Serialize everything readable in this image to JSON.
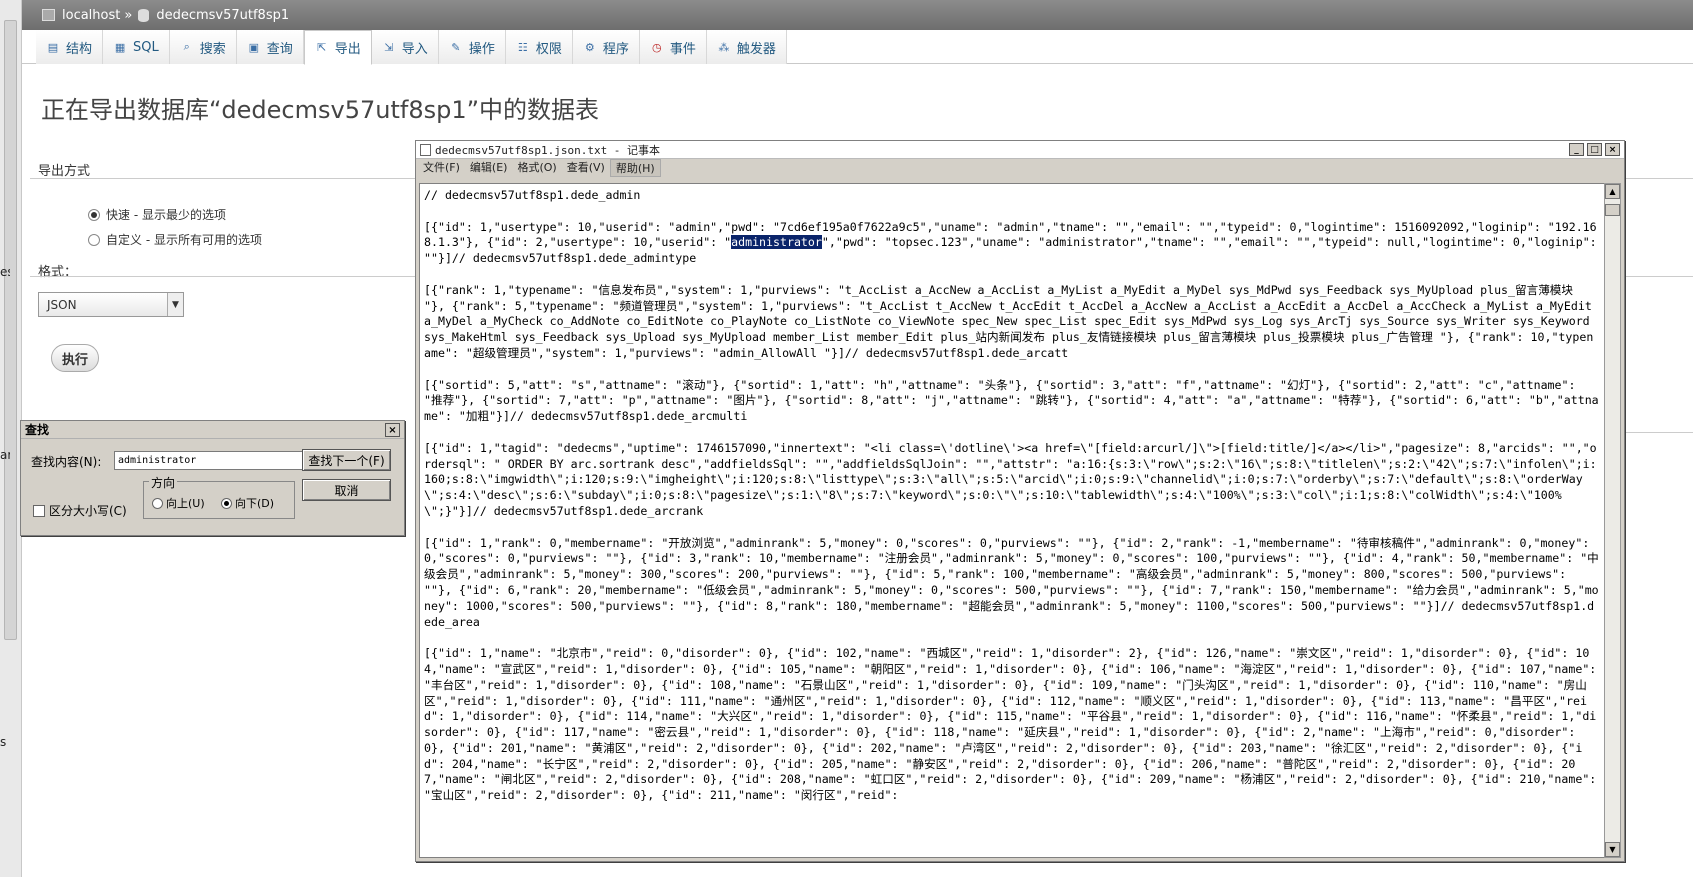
{
  "breadcrumb": {
    "server": "localhost",
    "separator": "»",
    "database": "dedecmsv57utf8sp1"
  },
  "tabs": [
    {
      "label": "结构",
      "icon": "structure-icon"
    },
    {
      "label": "SQL",
      "icon": "sql-icon"
    },
    {
      "label": "搜索",
      "icon": "search-icon"
    },
    {
      "label": "查询",
      "icon": "query-icon"
    },
    {
      "label": "导出",
      "icon": "export-icon"
    },
    {
      "label": "导入",
      "icon": "import-icon"
    },
    {
      "label": "操作",
      "icon": "wrench-icon"
    },
    {
      "label": "权限",
      "icon": "privileges-icon"
    },
    {
      "label": "程序",
      "icon": "routines-icon"
    },
    {
      "label": "事件",
      "icon": "clock-icon"
    },
    {
      "label": "触发器",
      "icon": "triggers-icon"
    }
  ],
  "active_tab": "导出",
  "page": {
    "title": "正在导出数据库“dedecmsv57utf8sp1”中的数据表",
    "export_method_label": "导出方式",
    "options": [
      {
        "label": "快速 - 显示最少的选项",
        "checked": true
      },
      {
        "label": "自定义 - 显示所有可用的选项",
        "checked": false
      }
    ],
    "format_label": "格式：",
    "format_value": "JSON",
    "execute_label": "执行"
  },
  "left_fragments": [
    "es",
    "ar",
    "s"
  ],
  "find_dialog": {
    "title": "查找",
    "close": "×",
    "find_what_label": "查找内容(N):",
    "find_value": "administrator",
    "find_next_label": "查找下一个(F)",
    "cancel_label": "取消",
    "direction_label": "方向",
    "up_label": "向上(U)",
    "down_label": "向下(D)",
    "match_case_label": "区分大小写(C)"
  },
  "notepad": {
    "title": "dedecmsv57utf8sp1.json.txt - 记事本",
    "menu": [
      "文件(F)",
      "编辑(E)",
      "格式(O)",
      "查看(V)",
      "帮助(H)"
    ],
    "controls": [
      "_",
      "□",
      "×"
    ],
    "text_before": "// dedecmsv57utf8sp1.dede_admin\n\n[{\"id\": 1,\"usertype\": 10,\"userid\": \"admin\",\"pwd\": \"7cd6ef195a0f7622a9c5\",\"uname\": \"admin\",\"tname\": \"\",\"email\": \"\",\"typeid\": 0,\"logintime\": 1516092092,\"loginip\": \"192.168.1.3\"}, {\"id\": 2,\"usertype\": 10,\"userid\": \"",
    "highlight": "administrator",
    "text_after": "\",\"pwd\": \"topsec.123\",\"uname\": \"administrator\",\"tname\": \"\",\"email\": \"\",\"typeid\": null,\"logintime\": 0,\"loginip\": \"\"}]// dedecmsv57utf8sp1.dede_admintype\n\n[{\"rank\": 1,\"typename\": \"信息发布员\",\"system\": 1,\"purviews\": \"t_AccList a_AccNew a_AccList a_MyList a_MyEdit a_MyDel sys_MdPwd sys_Feedback sys_MyUpload plus_留言薄模块 \"}, {\"rank\": 5,\"typename\": \"频道管理员\",\"system\": 1,\"purviews\": \"t_AccList t_AccNew t_AccEdit t_AccDel a_AccNew a_AccList a_AccEdit a_AccDel a_AccCheck a_MyList a_MyEdit a_MyDel a_MyCheck co_AddNote co_EditNote co_PlayNote co_ListNote co_ViewNote spec_New spec_List spec_Edit sys_MdPwd sys_Log sys_ArcTj sys_Source sys_Writer sys_Keyword sys_MakeHtml sys_Feedback sys_Upload sys_MyUpload member_List member_Edit plus_站内新闻发布 plus_友情链接模块 plus_留言薄模块 plus_投票模块 plus_广告管理 \"}, {\"rank\": 10,\"typename\": \"超级管理员\",\"system\": 1,\"purviews\": \"admin_AllowAll \"}]// dedecmsv57utf8sp1.dede_arcatt\n\n[{\"sortid\": 5,\"att\": \"s\",\"attname\": \"滚动\"}, {\"sortid\": 1,\"att\": \"h\",\"attname\": \"头条\"}, {\"sortid\": 3,\"att\": \"f\",\"attname\": \"幻灯\"}, {\"sortid\": 2,\"att\": \"c\",\"attname\": \"推荐\"}, {\"sortid\": 7,\"att\": \"p\",\"attname\": \"图片\"}, {\"sortid\": 8,\"att\": \"j\",\"attname\": \"跳转\"}, {\"sortid\": 4,\"att\": \"a\",\"attname\": \"特荐\"}, {\"sortid\": 6,\"att\": \"b\",\"attname\": \"加粗\"}]// dedecmsv57utf8sp1.dede_arcmulti\n\n[{\"id\": 1,\"tagid\": \"dedecms\",\"uptime\": 1746157090,\"innertext\": \"<li class=\\'dotline\\'><a href=\\\"[field:arcurl/]\\\">[field:title/]</a></li>\",\"pagesize\": 8,\"arcids\": \"\",\"ordersql\": \" ORDER BY arc.sortrank desc\",\"addfieldsSql\": \"\",\"addfieldsSqlJoin\": \"\",\"attstr\": \"a:16:{s:3:\\\"row\\\";s:2:\\\"16\\\";s:8:\\\"titlelen\\\";s:2:\\\"42\\\";s:7:\\\"infolen\\\";i:160;s:8:\\\"imgwidth\\\";i:120;s:9:\\\"imgheight\\\";i:120;s:8:\\\"listtype\\\";s:3:\\\"all\\\";s:5:\\\"arcid\\\";i:0;s:9:\\\"channelid\\\";i:0;s:7:\\\"orderby\\\";s:7:\\\"default\\\";s:8:\\\"orderWay\\\";s:4:\\\"desc\\\";s:6:\\\"subday\\\";i:0;s:8:\\\"pagesize\\\";s:1:\\\"8\\\";s:7:\\\"keyword\\\";s:0:\\\"\\\";s:10:\\\"tablewidth\\\";s:4:\\\"100%\\\";s:3:\\\"col\\\";i:1;s:8:\\\"colWidth\\\";s:4:\\\"100%\\\";}\"}]// dedecmsv57utf8sp1.dede_arcrank\n\n[{\"id\": 1,\"rank\": 0,\"membername\": \"开放浏览\",\"adminrank\": 5,\"money\": 0,\"scores\": 0,\"purviews\": \"\"}, {\"id\": 2,\"rank\": -1,\"membername\": \"待审核稿件\",\"adminrank\": 0,\"money\": 0,\"scores\": 0,\"purviews\": \"\"}, {\"id\": 3,\"rank\": 10,\"membername\": \"注册会员\",\"adminrank\": 5,\"money\": 0,\"scores\": 100,\"purviews\": \"\"}, {\"id\": 4,\"rank\": 50,\"membername\": \"中级会员\",\"adminrank\": 5,\"money\": 300,\"scores\": 200,\"purviews\": \"\"}, {\"id\": 5,\"rank\": 100,\"membername\": \"高级会员\",\"adminrank\": 5,\"money\": 800,\"scores\": 500,\"purviews\": \"\"}, {\"id\": 6,\"rank\": 20,\"membername\": \"低级会员\",\"adminrank\": 5,\"money\": 0,\"scores\": 500,\"purviews\": \"\"}, {\"id\": 7,\"rank\": 150,\"membername\": \"给力会员\",\"adminrank\": 5,\"money\": 1000,\"scores\": 500,\"purviews\": \"\"}, {\"id\": 8,\"rank\": 180,\"membername\": \"超能会员\",\"adminrank\": 5,\"money\": 1100,\"scores\": 500,\"purviews\": \"\"}]// dedecmsv57utf8sp1.dede_area\n\n[{\"id\": 1,\"name\": \"北京市\",\"reid\": 0,\"disorder\": 0}, {\"id\": 102,\"name\": \"西城区\",\"reid\": 1,\"disorder\": 2}, {\"id\": 126,\"name\": \"崇文区\",\"reid\": 1,\"disorder\": 0}, {\"id\": 104,\"name\": \"宣武区\",\"reid\": 1,\"disorder\": 0}, {\"id\": 105,\"name\": \"朝阳区\",\"reid\": 1,\"disorder\": 0}, {\"id\": 106,\"name\": \"海淀区\",\"reid\": 1,\"disorder\": 0}, {\"id\": 107,\"name\": \"丰台区\",\"reid\": 1,\"disorder\": 0}, {\"id\": 108,\"name\": \"石景山区\",\"reid\": 1,\"disorder\": 0}, {\"id\": 109,\"name\": \"门头沟区\",\"reid\": 1,\"disorder\": 0}, {\"id\": 110,\"name\": \"房山区\",\"reid\": 1,\"disorder\": 0}, {\"id\": 111,\"name\": \"通州区\",\"reid\": 1,\"disorder\": 0}, {\"id\": 112,\"name\": \"顺义区\",\"reid\": 1,\"disorder\": 0}, {\"id\": 113,\"name\": \"昌平区\",\"reid\": 1,\"disorder\": 0}, {\"id\": 114,\"name\": \"大兴区\",\"reid\": 1,\"disorder\": 0}, {\"id\": 115,\"name\": \"平谷县\",\"reid\": 1,\"disorder\": 0}, {\"id\": 116,\"name\": \"怀柔县\",\"reid\": 1,\"disorder\": 0}, {\"id\": 117,\"name\": \"密云县\",\"reid\": 1,\"disorder\": 0}, {\"id\": 118,\"name\": \"延庆县\",\"reid\": 1,\"disorder\": 0}, {\"id\": 2,\"name\": \"上海市\",\"reid\": 0,\"disorder\": 0}, {\"id\": 201,\"name\": \"黄浦区\",\"reid\": 2,\"disorder\": 0}, {\"id\": 202,\"name\": \"卢湾区\",\"reid\": 2,\"disorder\": 0}, {\"id\": 203,\"name\": \"徐汇区\",\"reid\": 2,\"disorder\": 0}, {\"id\": 204,\"name\": \"长宁区\",\"reid\": 2,\"disorder\": 0}, {\"id\": 205,\"name\": \"静安区\",\"reid\": 2,\"disorder\": 0}, {\"id\": 206,\"name\": \"普陀区\",\"reid\": 2,\"disorder\": 0}, {\"id\": 207,\"name\": \"闸北区\",\"reid\": 2,\"disorder\": 0}, {\"id\": 208,\"name\": \"虹口区\",\"reid\": 2,\"disorder\": 0}, {\"id\": 209,\"name\": \"杨浦区\",\"reid\": 2,\"disorder\": 0}, {\"id\": 210,\"name\": \"宝山区\",\"reid\": 2,\"disorder\": 0}, {\"id\": 211,\"name\": \"闵行区\",\"reid\":"
  }
}
